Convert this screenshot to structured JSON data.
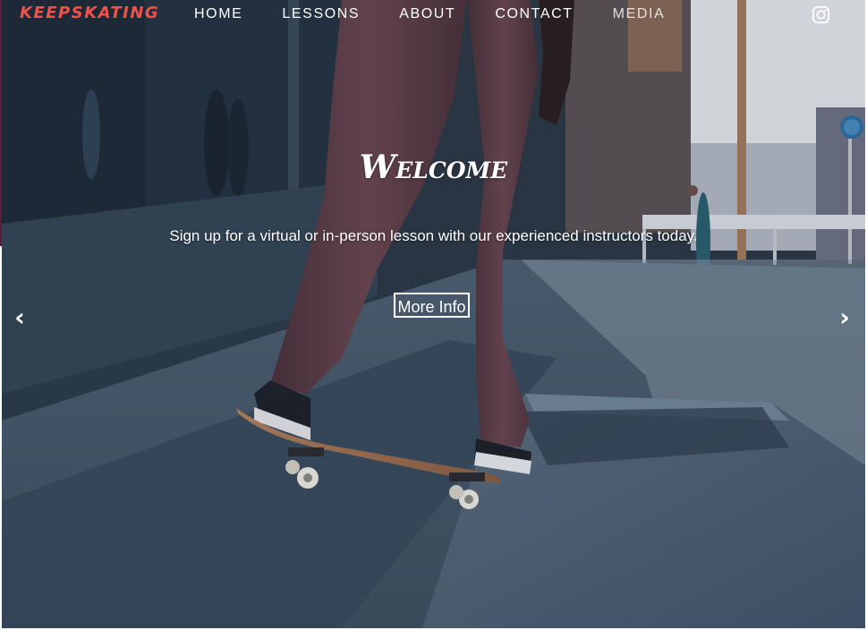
{
  "brand": {
    "logo_text": "KEEPSKATING",
    "color": "#f0524b"
  },
  "nav": {
    "items": [
      {
        "label": "HOME"
      },
      {
        "label": "LESSONS"
      },
      {
        "label": "ABOUT"
      },
      {
        "label": "CONTACT"
      },
      {
        "label": "MEDIA"
      }
    ],
    "social_icon": "instagram-icon"
  },
  "hero": {
    "heading": "Welcome",
    "subtitle": "Sign up for a virtual or in-person lesson with our experienced instructors today.",
    "button_label": "More Info",
    "prev_label": "‹",
    "next_label": "›",
    "background": "skateboarder-on-ledge-photo"
  }
}
